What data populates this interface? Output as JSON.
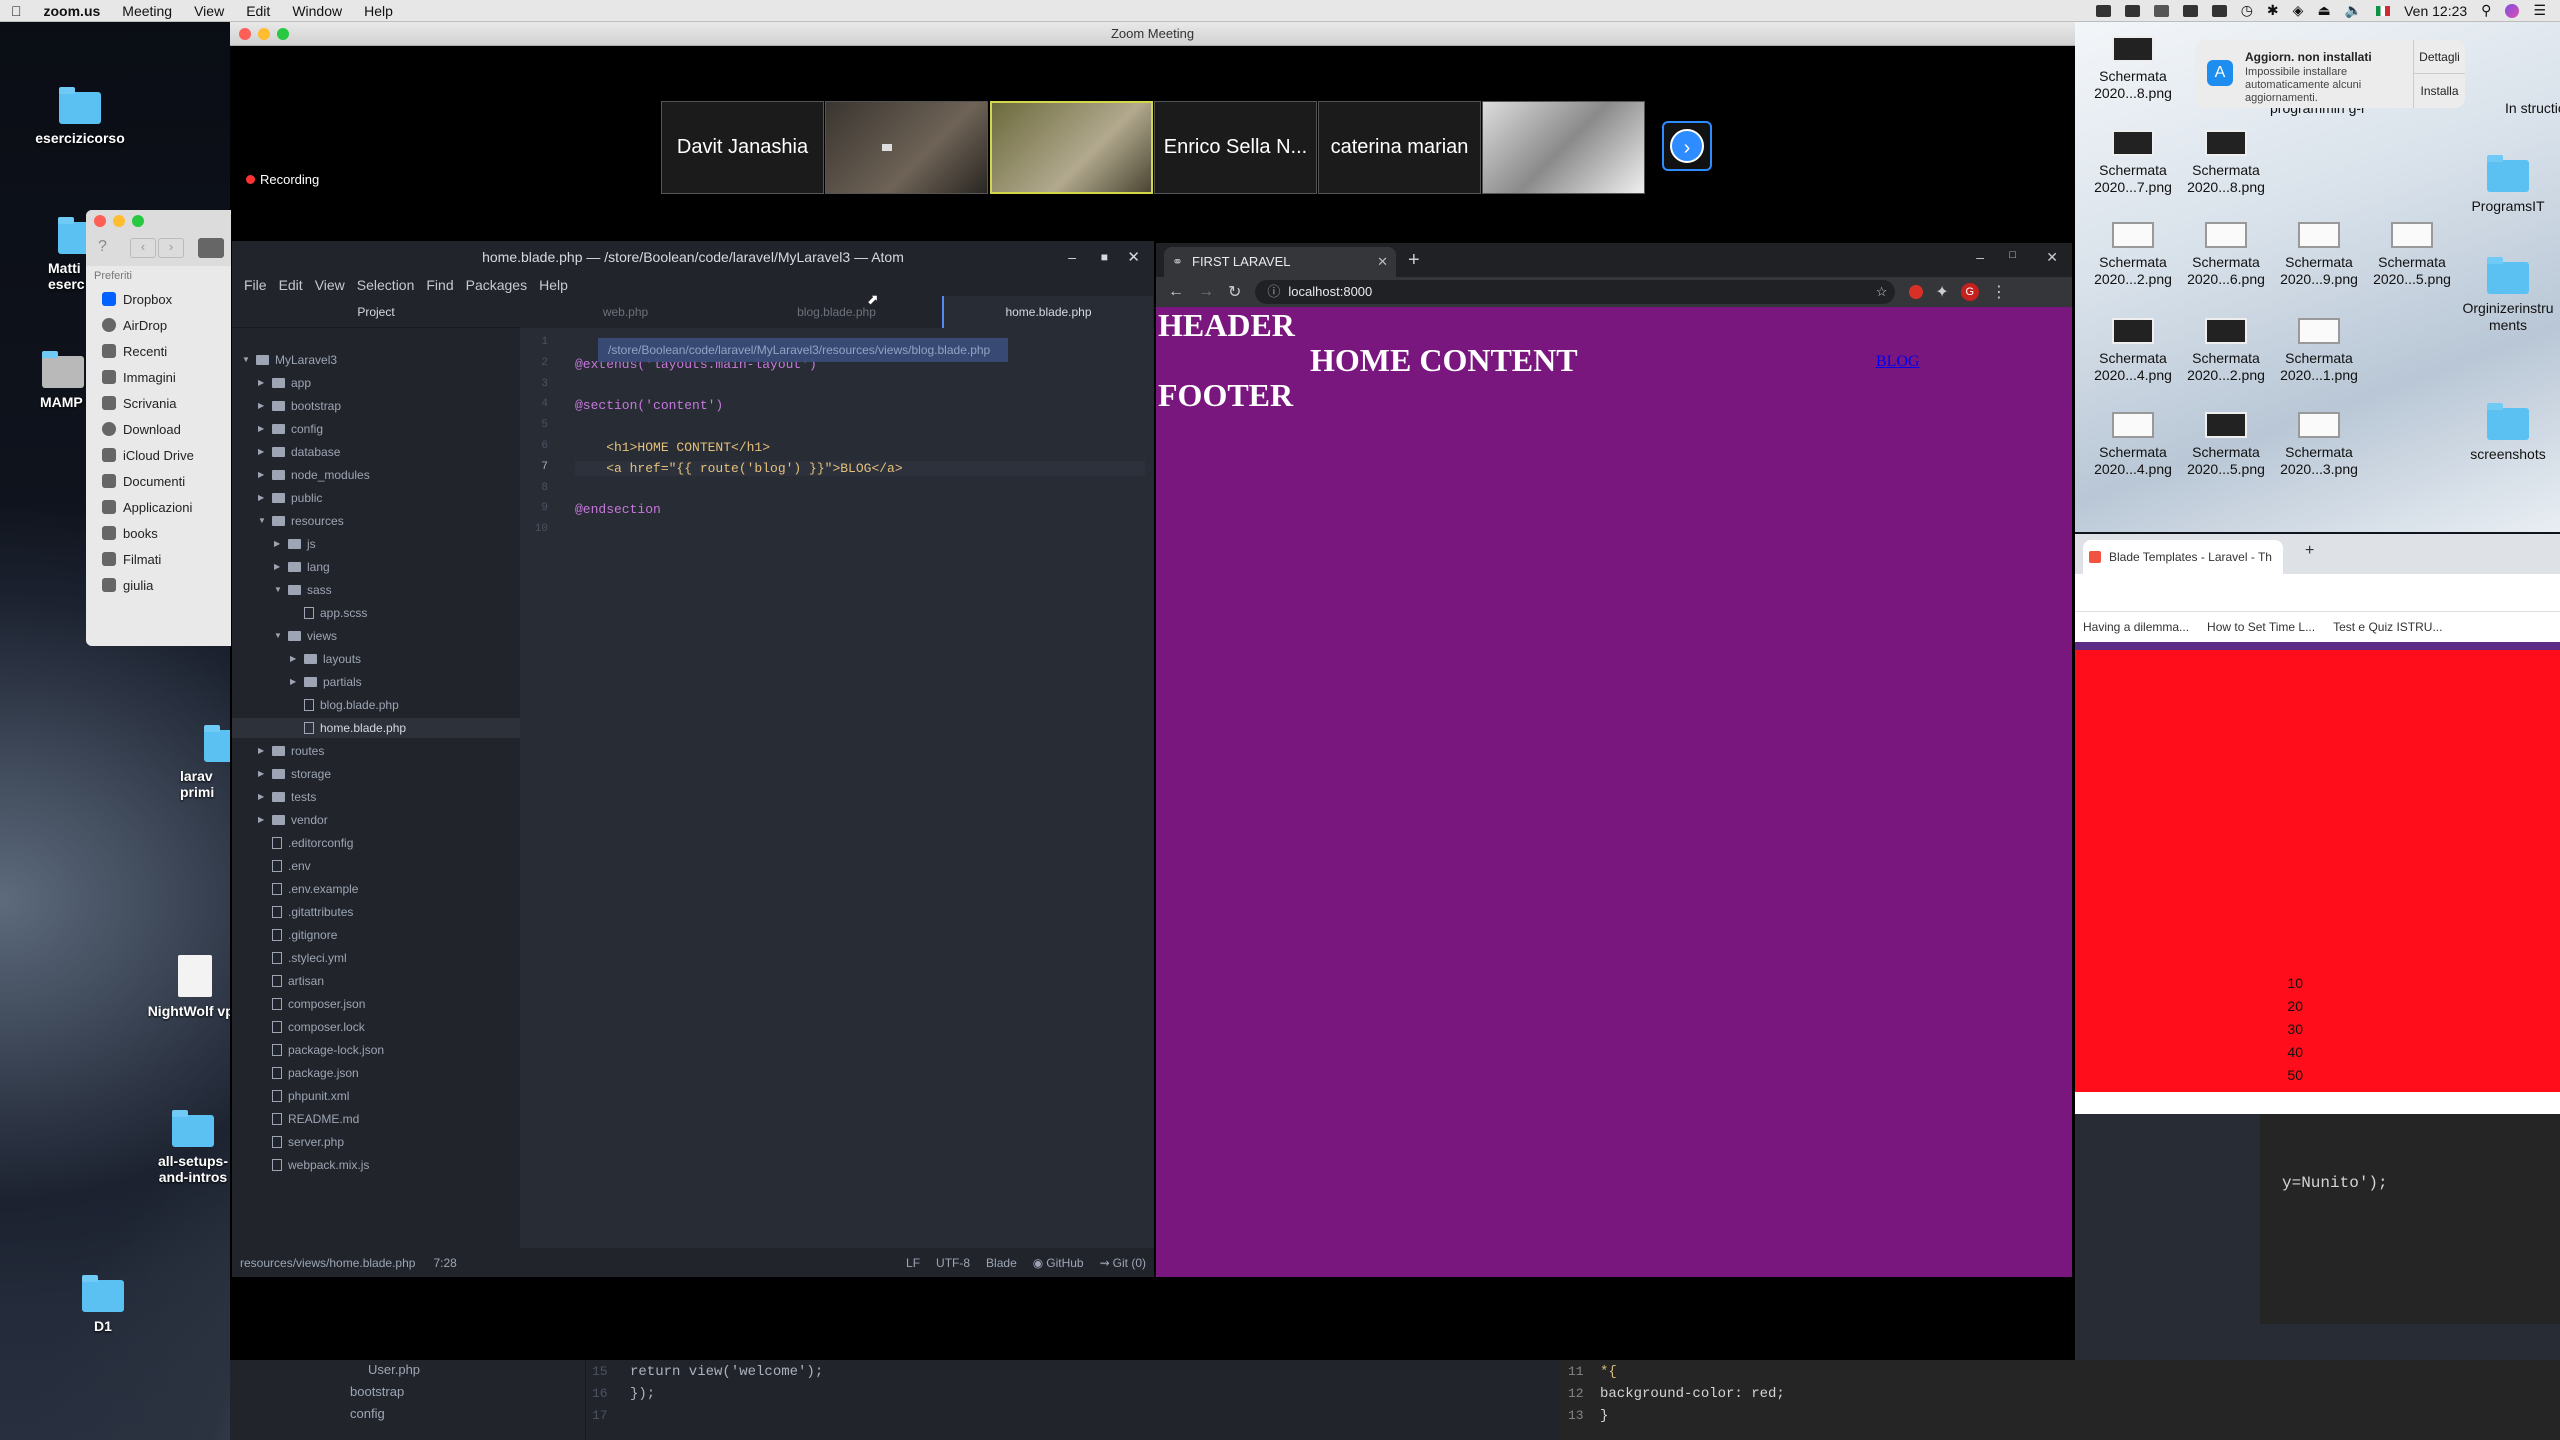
{
  "menubar": {
    "app": "zoom.us",
    "items": [
      "Meeting",
      "View",
      "Edit",
      "Window",
      "Help"
    ],
    "clock": "Ven 12:23"
  },
  "desktop": {
    "left_icons": [
      {
        "label": "esercizicorso",
        "type": "folder"
      },
      {
        "label": "Matti eserc",
        "type": "folder"
      },
      {
        "label": "MAMP",
        "type": "folder"
      },
      {
        "label": "larav primi",
        "type": "folder"
      },
      {
        "label": "NightWolf vpn",
        "type": "doc"
      },
      {
        "label": "all-setups-and-intros",
        "type": "folder"
      },
      {
        "label": "D1",
        "type": "folder"
      }
    ],
    "right_thumbs": [
      {
        "label": "Schermata 2020...8.png",
        "dark": true
      },
      {
        "label": "Schermata 2020...7.png",
        "dark": true
      },
      {
        "label": "Schermata 2020...8.png",
        "dark": true
      },
      {
        "label": "Schermata 2020...2.png",
        "dark": false
      },
      {
        "label": "Schermata 2020...6.png",
        "dark": false
      },
      {
        "label": "Schermata 2020...9.png",
        "dark": false
      },
      {
        "label": "Schermata 2020...5.png",
        "dark": false
      },
      {
        "label": "Schermata 2020...4.png",
        "dark": true
      },
      {
        "label": "Schermata 2020...2.png",
        "dark": true
      },
      {
        "label": "Schermata 2020...1.png",
        "dark": false
      },
      {
        "label": "Schermata 2020...4.png",
        "dark": false
      },
      {
        "label": "Schermata 2020...5.png",
        "dark": true
      },
      {
        "label": "Schermata 2020...3.png",
        "dark": false
      }
    ],
    "right_folders": [
      "ProgramsIT",
      "Orginizerinstruments",
      "screenshots"
    ],
    "right_partial": [
      "programmin g-materials",
      "In structions"
    ]
  },
  "notification": {
    "title": "Aggiorn. non installati",
    "body": "Impossibile installare automaticamente alcuni aggiornamenti.",
    "details": "Dettagli",
    "install": "Installa"
  },
  "zoom": {
    "title": "Zoom Meeting",
    "recording": "Recording",
    "participants": [
      {
        "name": "Davit Janashia",
        "video": false
      },
      {
        "name": "",
        "video": true
      },
      {
        "name": "",
        "video": true
      },
      {
        "name": "Enrico Sella N...",
        "video": false
      },
      {
        "name": "caterina marian",
        "video": false
      },
      {
        "name": "",
        "video": true
      }
    ]
  },
  "finder": {
    "section": "Preferiti",
    "items": [
      "Dropbox",
      "AirDrop",
      "Recenti",
      "Immagini",
      "Scrivania",
      "Download",
      "iCloud Drive",
      "Documenti",
      "Applicazioni",
      "books",
      "Filmati",
      "giulia"
    ]
  },
  "atom": {
    "title": "home.blade.php — /store/Boolean/code/laravel/MyLaravel3 — Atom",
    "menu": [
      "File",
      "Edit",
      "View",
      "Selection",
      "Find",
      "Packages",
      "Help"
    ],
    "tree_header": "Project",
    "tree": [
      {
        "label": "MyLaravel3",
        "kind": "root",
        "depth": 0
      },
      {
        "label": "app",
        "kind": "dir",
        "depth": 1
      },
      {
        "label": "bootstrap",
        "kind": "dir",
        "depth": 1
      },
      {
        "label": "config",
        "kind": "dir",
        "depth": 1
      },
      {
        "label": "database",
        "kind": "dir",
        "depth": 1
      },
      {
        "label": "node_modules",
        "kind": "dir",
        "depth": 1
      },
      {
        "label": "public",
        "kind": "dir",
        "depth": 1
      },
      {
        "label": "resources",
        "kind": "open",
        "depth": 1
      },
      {
        "label": "js",
        "kind": "dir",
        "depth": 2
      },
      {
        "label": "lang",
        "kind": "dir",
        "depth": 2
      },
      {
        "label": "sass",
        "kind": "open",
        "depth": 2
      },
      {
        "label": "app.scss",
        "kind": "file",
        "depth": 3
      },
      {
        "label": "views",
        "kind": "open",
        "depth": 2
      },
      {
        "label": "layouts",
        "kind": "dir",
        "depth": 3
      },
      {
        "label": "partials",
        "kind": "dir",
        "depth": 3
      },
      {
        "label": "blog.blade.php",
        "kind": "file",
        "depth": 3
      },
      {
        "label": "home.blade.php",
        "kind": "file",
        "depth": 3,
        "selected": true
      },
      {
        "label": "routes",
        "kind": "dir",
        "depth": 1
      },
      {
        "label": "storage",
        "kind": "dir",
        "depth": 1
      },
      {
        "label": "tests",
        "kind": "dir",
        "depth": 1
      },
      {
        "label": "vendor",
        "kind": "dir",
        "depth": 1
      },
      {
        "label": ".editorconfig",
        "kind": "file",
        "depth": 1
      },
      {
        "label": ".env",
        "kind": "file",
        "depth": 1
      },
      {
        "label": ".env.example",
        "kind": "file",
        "depth": 1
      },
      {
        "label": ".gitattributes",
        "kind": "file",
        "depth": 1
      },
      {
        "label": ".gitignore",
        "kind": "file",
        "depth": 1
      },
      {
        "label": ".styleci.yml",
        "kind": "file",
        "depth": 1
      },
      {
        "label": "artisan",
        "kind": "file",
        "depth": 1
      },
      {
        "label": "composer.json",
        "kind": "file",
        "depth": 1
      },
      {
        "label": "composer.lock",
        "kind": "file",
        "depth": 1
      },
      {
        "label": "package-lock.json",
        "kind": "file",
        "depth": 1
      },
      {
        "label": "package.json",
        "kind": "file",
        "depth": 1
      },
      {
        "label": "phpunit.xml",
        "kind": "file",
        "depth": 1
      },
      {
        "label": "README.md",
        "kind": "file",
        "depth": 1
      },
      {
        "label": "server.php",
        "kind": "file",
        "depth": 1
      },
      {
        "label": "webpack.mix.js",
        "kind": "file",
        "depth": 1
      }
    ],
    "tabs": [
      "web.php",
      "blog.blade.php",
      "home.blade.php"
    ],
    "tooltip": "/store/Boolean/code/laravel/MyLaravel3/resources/views/blog.blade.php",
    "code": [
      {
        "n": "1",
        "text": ""
      },
      {
        "n": "2",
        "text": "@extends('layouts.main-layout')"
      },
      {
        "n": "3",
        "text": ""
      },
      {
        "n": "4",
        "text": "@section('content')"
      },
      {
        "n": "5",
        "text": ""
      },
      {
        "n": "6",
        "text": "    <h1>HOME CONTENT</h1>"
      },
      {
        "n": "7",
        "text": "    <a href=\"{{ route('blog') }}\">BLOG</a>"
      },
      {
        "n": "8",
        "text": ""
      },
      {
        "n": "9",
        "text": "@endsection"
      },
      {
        "n": "10",
        "text": ""
      }
    ],
    "status": {
      "path": "resources/views/home.blade.php",
      "cursor": "7:28",
      "eol": "LF",
      "encoding": "UTF-8",
      "grammar": "Blade",
      "github": "GitHub",
      "git": "Git (0)"
    }
  },
  "chrome": {
    "tab_title": "FIRST LARAVEL",
    "url": "localhost:8000",
    "avatar": "G",
    "page": {
      "header": "HEADER",
      "content": "HOME CONTENT",
      "link": "BLOG",
      "footer": "FOOTER"
    }
  },
  "bg_browser": {
    "tab_title": "Blade Templates - Laravel - Th",
    "bookmarks": [
      "Having a dilemma...",
      "How to Set Time L...",
      "Test e Quiz ISTRU..."
    ],
    "numbers": [
      "10",
      "20",
      "30",
      "40",
      "50"
    ],
    "code_fragment": "y=Nunito');"
  },
  "bg_editor": {
    "left": [
      {
        "n": "",
        "text": "User.php"
      },
      {
        "n": "",
        "text": "bootstrap"
      },
      {
        "n": "",
        "text": "config"
      }
    ],
    "mid": [
      {
        "n": "15",
        "text": "    return view('welcome');"
      },
      {
        "n": "16",
        "text": "});"
      },
      {
        "n": "17",
        "text": ""
      }
    ],
    "right": [
      {
        "n": "11",
        "text": "*{"
      },
      {
        "n": "12",
        "text": "  background-color: red;"
      },
      {
        "n": "13",
        "text": "}"
      }
    ]
  },
  "colors": {
    "page_bg": "#7a177f",
    "bg_red": "#ff0d1a",
    "atom_bg": "#282c34",
    "atom_panel": "#21252b",
    "zoom_bg": "#000000",
    "active_tab_accent": "#568af2"
  }
}
